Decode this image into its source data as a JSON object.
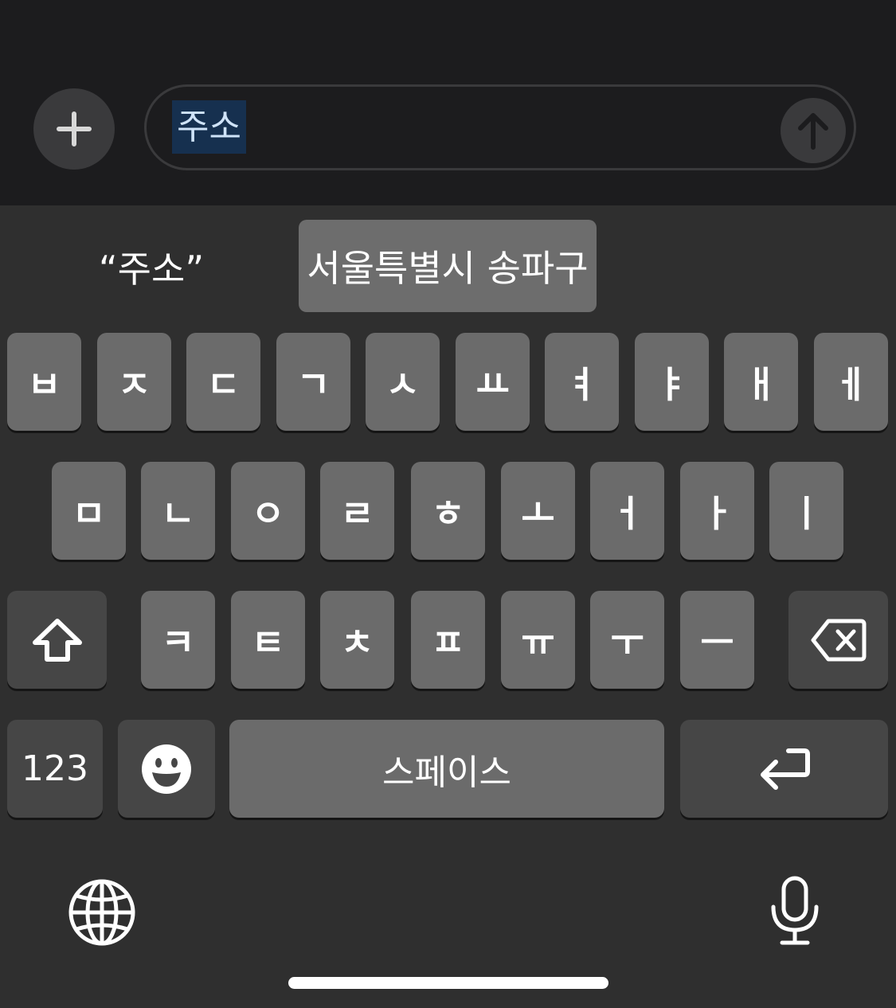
{
  "message_input": {
    "value": "주소"
  },
  "suggestions": [
    "“주소”",
    "서울특별시 송파구"
  ],
  "keyboard": {
    "row1": [
      "ㅂ",
      "ㅈ",
      "ㄷ",
      "ㄱ",
      "ㅅ",
      "ㅛ",
      "ㅕ",
      "ㅑ",
      "ㅐ",
      "ㅔ"
    ],
    "row2": [
      "ㅁ",
      "ㄴ",
      "ㅇ",
      "ㄹ",
      "ㅎ",
      "ㅗ",
      "ㅓ",
      "ㅏ",
      "ㅣ"
    ],
    "row3": [
      "ㅋ",
      "ㅌ",
      "ㅊ",
      "ㅍ",
      "ㅠ",
      "ㅜ",
      "ㅡ"
    ],
    "numbers_label": "123",
    "space_label": "스페이스"
  },
  "icons": {
    "plus": "plus-icon",
    "send": "arrow-up-icon",
    "shift": "shift-icon",
    "delete": "delete-icon",
    "emoji": "emoji-icon",
    "return": "return-icon",
    "globe": "globe-icon",
    "mic": "microphone-icon"
  },
  "colors": {
    "background": "#1c1c1e",
    "keyboard_bg": "#2f2f2f",
    "key_light": "#6b6b6b",
    "key_dark": "#464646",
    "selection": "#16304f"
  }
}
